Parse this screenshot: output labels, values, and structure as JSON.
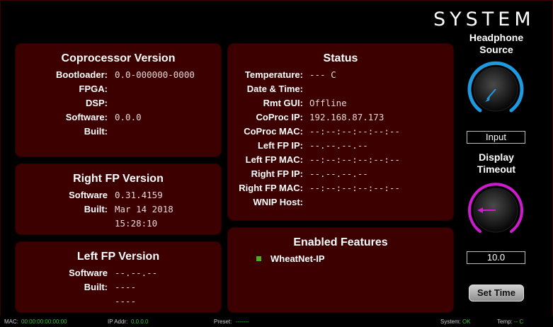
{
  "header": {
    "title": "SYSTEM"
  },
  "coprocessor": {
    "title": "Coprocessor Version",
    "rows": [
      {
        "label": "Bootloader:",
        "value": "0.0-000000-0000"
      },
      {
        "label": "FPGA:",
        "value": ""
      },
      {
        "label": "DSP:",
        "value": ""
      },
      {
        "label": "Software:",
        "value": "0.0.0"
      },
      {
        "label": "Built:",
        "value": ""
      }
    ]
  },
  "right_fp": {
    "title": "Right FP Version",
    "software_label": "Software",
    "software_value": "0.31.4159",
    "built_label": "Built:",
    "built_date": "Mar 14 2018",
    "built_time": "15:28:10"
  },
  "left_fp": {
    "title": "Left FP Version",
    "software_label": "Software",
    "software_value": "--.--.--",
    "built_label": "Built:",
    "built_date": "----",
    "built_time": "----"
  },
  "status": {
    "title": "Status",
    "rows": [
      {
        "label": "Temperature:",
        "value": "--- C"
      },
      {
        "label": "Date & Time:",
        "value": ""
      },
      {
        "label": "Rmt GUI:",
        "value": "Offline"
      },
      {
        "label": "CoProc IP:",
        "value": "192.168.87.173"
      },
      {
        "label": "CoProc MAC:",
        "value": "--:--:--:--:--:--"
      },
      {
        "label": "Left FP IP:",
        "value": "--.--.--.--"
      },
      {
        "label": "Left FP MAC:",
        "value": "--:--:--:--:--:--"
      },
      {
        "label": "Right FP IP:",
        "value": "--.--.--.--"
      },
      {
        "label": "Right FP MAC:",
        "value": "--:--:--:--:--:--"
      },
      {
        "label": "WNIP Host:",
        "value": ""
      }
    ]
  },
  "features": {
    "title": "Enabled Features",
    "items": [
      {
        "label": "WheatNet-IP"
      }
    ]
  },
  "sidebar": {
    "headphone_label_line1": "Headphone",
    "headphone_label_line2": "Source",
    "headphone_value": "Input",
    "headphone_color": "#1e9be0",
    "display_label_line1": "Display",
    "display_label_line2": "Timeout",
    "display_value": "10.0",
    "display_color": "#d01ad0",
    "set_time_label": "Set Time"
  },
  "status_bar": {
    "mac_label": "MAC:",
    "mac_value": "00:00:00:00:00:00",
    "ip_label": "IP Addr:",
    "ip_value": "0.0.0.0",
    "preset_label": "Preset:",
    "preset_value": "-------",
    "system_label": "System:",
    "system_value": "OK",
    "temp_label": "Temp:",
    "temp_value": "-- C",
    "ok_color": "#3fbf3f"
  }
}
